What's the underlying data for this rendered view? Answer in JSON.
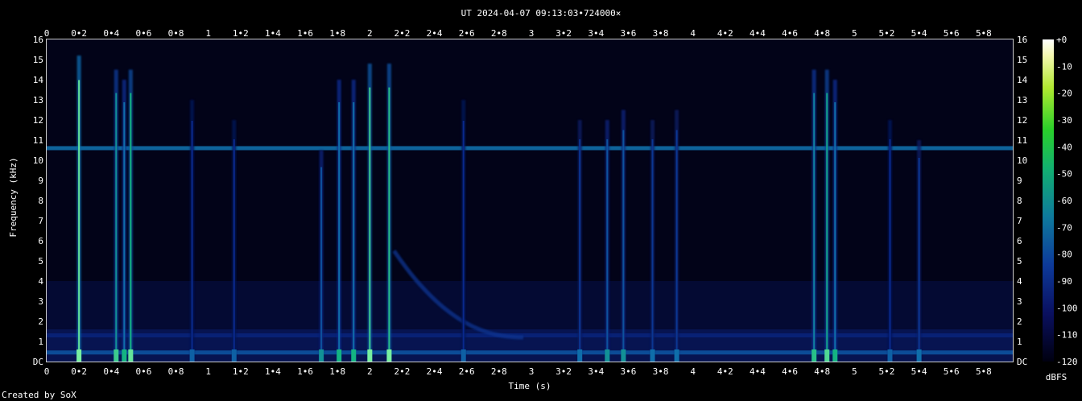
{
  "chart_data": {
    "type": "heatmap",
    "title": "UT 2024-04-07 09:13:03•724000×",
    "xlabel": "Time (s)",
    "ylabel": "Frequency (kHz)",
    "xlim": [
      0,
      5.98
    ],
    "ylim": [
      0,
      16
    ],
    "x_ticks": [
      "0",
      "0•2",
      "0•4",
      "0•6",
      "0•8",
      "1",
      "1•2",
      "1•4",
      "1•6",
      "1•8",
      "2",
      "2•2",
      "2•4",
      "2•6",
      "2•8",
      "3",
      "3•2",
      "3•4",
      "3•6",
      "3•8",
      "4",
      "4•2",
      "4•4",
      "4•6",
      "4•8",
      "5",
      "5•2",
      "5•4",
      "5•6",
      "5•8"
    ],
    "y_ticks": [
      "DC",
      "1",
      "2",
      "3",
      "4",
      "5",
      "6",
      "7",
      "8",
      "9",
      "10",
      "11",
      "12",
      "13",
      "14",
      "15",
      "16"
    ],
    "colorbar": {
      "label": "dBFS",
      "ticks": [
        "+0",
        "-10",
        "-20",
        "-30",
        "-40",
        "-50",
        "-60",
        "-70",
        "-80",
        "-90",
        "-100",
        "-110",
        "-120"
      ],
      "range": [
        -120,
        0
      ]
    },
    "horizontal_lines_khz": [
      {
        "freq": 10.6,
        "intensity": 0.55
      },
      {
        "freq": 1.3,
        "intensity": 0.25
      },
      {
        "freq": 0.45,
        "intensity": 0.45
      }
    ],
    "transients": [
      {
        "t": 0.2,
        "fmax": 15.2,
        "intensity": 0.95
      },
      {
        "t": 0.43,
        "fmax": 14.5,
        "intensity": 0.65
      },
      {
        "t": 0.48,
        "fmax": 14.0,
        "intensity": 0.55
      },
      {
        "t": 0.52,
        "fmax": 14.5,
        "intensity": 0.75
      },
      {
        "t": 0.9,
        "fmax": 13.0,
        "intensity": 0.3
      },
      {
        "t": 1.16,
        "fmax": 12.0,
        "intensity": 0.3
      },
      {
        "t": 1.7,
        "fmax": 10.5,
        "intensity": 0.45
      },
      {
        "t": 1.81,
        "fmax": 14.0,
        "intensity": 0.55
      },
      {
        "t": 1.9,
        "fmax": 14.0,
        "intensity": 0.55
      },
      {
        "t": 2.0,
        "fmax": 14.8,
        "intensity": 0.85
      },
      {
        "t": 2.12,
        "fmax": 14.8,
        "intensity": 0.8
      },
      {
        "t": 2.58,
        "fmax": 13.0,
        "intensity": 0.3
      },
      {
        "t": 3.3,
        "fmax": 12.0,
        "intensity": 0.35
      },
      {
        "t": 3.47,
        "fmax": 12.0,
        "intensity": 0.45
      },
      {
        "t": 3.57,
        "fmax": 12.5,
        "intensity": 0.45
      },
      {
        "t": 3.75,
        "fmax": 12.0,
        "intensity": 0.35
      },
      {
        "t": 3.9,
        "fmax": 12.5,
        "intensity": 0.35
      },
      {
        "t": 4.75,
        "fmax": 14.5,
        "intensity": 0.6
      },
      {
        "t": 4.83,
        "fmax": 14.5,
        "intensity": 0.7
      },
      {
        "t": 4.88,
        "fmax": 14.0,
        "intensity": 0.55
      },
      {
        "t": 5.22,
        "fmax": 12.0,
        "intensity": 0.3
      },
      {
        "t": 5.4,
        "fmax": 11.0,
        "intensity": 0.35
      }
    ],
    "sweep": {
      "t_start": 2.15,
      "f_start": 5.5,
      "t_end": 2.95,
      "f_end": 1.2,
      "intensity": 0.35
    }
  },
  "footer": {
    "credit": "Created by SoX"
  },
  "colors": {
    "background": "#000000",
    "plot_background": "#020318",
    "text": "#ffffff",
    "frame": "#cccccc"
  }
}
